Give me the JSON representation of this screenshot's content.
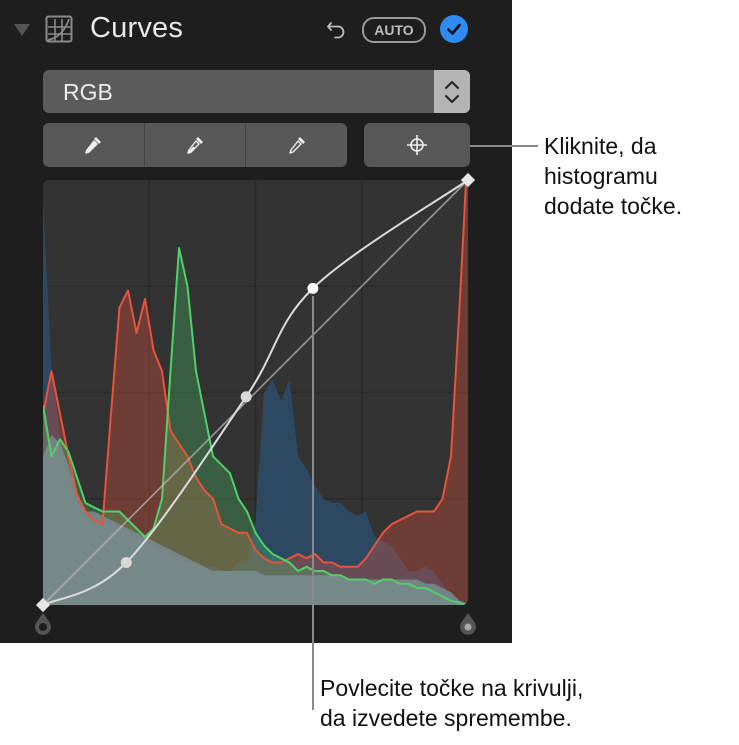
{
  "header": {
    "title": "Curves",
    "auto_label": "AUTO",
    "icons": {
      "disclosure": "disclosure-triangle-icon",
      "curves": "curves-adjustment-icon",
      "undo": "undo-icon",
      "enabled": "checkmark-circle-icon"
    }
  },
  "channel_select": {
    "value": "RGB",
    "icon": "up-down-chevron-icon"
  },
  "tools": {
    "eyedroppers": [
      {
        "name": "black-point-eyedropper",
        "icon": "eyedropper-filled-icon"
      },
      {
        "name": "midtone-eyedropper",
        "icon": "eyedropper-half-icon"
      },
      {
        "name": "white-point-eyedropper",
        "icon": "eyedropper-outline-icon"
      }
    ],
    "add_points": {
      "icon": "crosshair-icon"
    }
  },
  "colors": {
    "accent": "#2f8bf0",
    "red": "#e8533d",
    "green": "#4fd06a",
    "blue": "#2d4e6b",
    "luma": "#7a8c8f",
    "curve": "#dcdcdc"
  },
  "chart_data": {
    "type": "area",
    "title": "",
    "xlabel": "",
    "ylabel": "",
    "xlim": [
      0,
      1
    ],
    "ylim": [
      0,
      1
    ],
    "grid": "4x4",
    "curve_points": [
      [
        0,
        0
      ],
      [
        0.196,
        0.1
      ],
      [
        0.478,
        0.49
      ],
      [
        0.635,
        0.745
      ],
      [
        1,
        1
      ]
    ],
    "identity_line": [
      [
        0,
        0
      ],
      [
        1,
        1
      ]
    ],
    "histogram_x": [
      0,
      0.02,
      0.04,
      0.06,
      0.08,
      0.1,
      0.12,
      0.14,
      0.16,
      0.18,
      0.2,
      0.22,
      0.24,
      0.26,
      0.28,
      0.3,
      0.32,
      0.34,
      0.36,
      0.38,
      0.4,
      0.42,
      0.44,
      0.46,
      0.48,
      0.5,
      0.52,
      0.54,
      0.56,
      0.58,
      0.6,
      0.62,
      0.64,
      0.66,
      0.68,
      0.7,
      0.72,
      0.74,
      0.76,
      0.78,
      0.8,
      0.82,
      0.84,
      0.86,
      0.88,
      0.9,
      0.92,
      0.94,
      0.96,
      0.98,
      0.995,
      1.0
    ],
    "series": [
      {
        "name": "Luminance",
        "values": [
          0.35,
          0.4,
          0.38,
          0.33,
          0.26,
          0.22,
          0.22,
          0.21,
          0.2,
          0.19,
          0.18,
          0.17,
          0.16,
          0.15,
          0.14,
          0.13,
          0.12,
          0.11,
          0.1,
          0.09,
          0.08,
          0.08,
          0.08,
          0.08,
          0.08,
          0.08,
          0.07,
          0.07,
          0.07,
          0.07,
          0.07,
          0.07,
          0.07,
          0.07,
          0.07,
          0.07,
          0.06,
          0.06,
          0.06,
          0.06,
          0.06,
          0.06,
          0.06,
          0.06,
          0.06,
          0.05,
          0.05,
          0.04,
          0.03,
          0.01,
          0.005,
          0.0
        ]
      },
      {
        "name": "Red",
        "values": [
          0.45,
          0.55,
          0.45,
          0.35,
          0.26,
          0.22,
          0.2,
          0.19,
          0.45,
          0.7,
          0.74,
          0.64,
          0.72,
          0.6,
          0.55,
          0.41,
          0.38,
          0.35,
          0.3,
          0.27,
          0.25,
          0.19,
          0.18,
          0.17,
          0.17,
          0.13,
          0.11,
          0.1,
          0.1,
          0.11,
          0.12,
          0.11,
          0.12,
          0.1,
          0.1,
          0.09,
          0.09,
          0.09,
          0.11,
          0.14,
          0.17,
          0.19,
          0.2,
          0.21,
          0.22,
          0.22,
          0.22,
          0.25,
          0.35,
          0.7,
          0.99,
          1.0
        ]
      },
      {
        "name": "Green",
        "values": [
          0.47,
          0.35,
          0.39,
          0.36,
          0.3,
          0.24,
          0.23,
          0.22,
          0.22,
          0.22,
          0.2,
          0.18,
          0.16,
          0.18,
          0.25,
          0.55,
          0.84,
          0.75,
          0.55,
          0.45,
          0.35,
          0.33,
          0.31,
          0.25,
          0.22,
          0.17,
          0.14,
          0.12,
          0.11,
          0.1,
          0.08,
          0.09,
          0.08,
          0.08,
          0.07,
          0.07,
          0.06,
          0.06,
          0.06,
          0.05,
          0.06,
          0.06,
          0.05,
          0.05,
          0.04,
          0.04,
          0.03,
          0.02,
          0.01,
          0.005,
          0.0,
          0.0
        ]
      },
      {
        "name": "Blue",
        "values": [
          0.95,
          0.55,
          0.4,
          0.3,
          0.24,
          0.22,
          0.21,
          0.2,
          0.19,
          0.18,
          0.17,
          0.16,
          0.15,
          0.14,
          0.13,
          0.12,
          0.11,
          0.1,
          0.1,
          0.09,
          0.09,
          0.08,
          0.08,
          0.1,
          0.1,
          0.2,
          0.5,
          0.53,
          0.48,
          0.53,
          0.35,
          0.32,
          0.28,
          0.25,
          0.24,
          0.24,
          0.22,
          0.21,
          0.22,
          0.16,
          0.15,
          0.14,
          0.11,
          0.08,
          0.08,
          0.09,
          0.08,
          0.05,
          0.02,
          0.01,
          0.0,
          0.0
        ]
      }
    ]
  },
  "callouts": [
    {
      "lines": [
        "Kliknite, da",
        "histogramu",
        "dodate točke."
      ]
    },
    {
      "lines": [
        "Povlecite točke na krivulji,",
        "da izvedete spremembe."
      ]
    }
  ]
}
